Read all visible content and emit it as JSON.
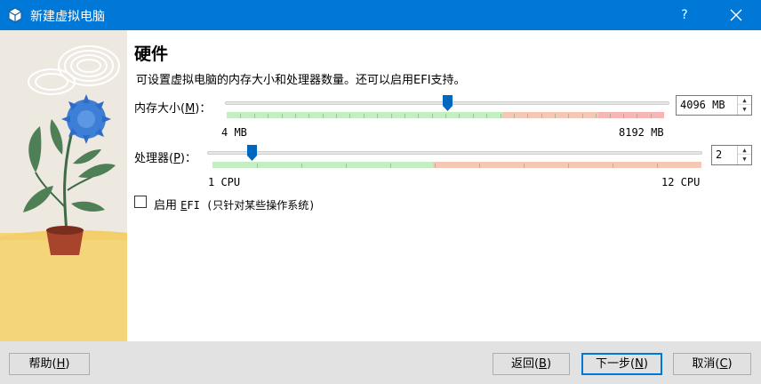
{
  "window": {
    "title": "新建虚拟电脑",
    "help_label": "?",
    "icon": "virtualbox-cube-icon",
    "close_icon": "close-icon"
  },
  "hardware": {
    "heading": "硬件",
    "description": "可设置虚拟电脑的内存大小和处理器数量。还可以启用EFI支持。",
    "memory": {
      "label_prefix": "内存大小(",
      "label_mnemonic": "M",
      "label_suffix": ")：",
      "value": "4096 MB",
      "min_label": "4 MB",
      "max_label": "8192 MB",
      "slider_fraction": 0.5,
      "zones": {
        "green_end": 0.63,
        "orange_end": 0.85
      },
      "colors": {
        "green": "#c3efc3",
        "orange": "#f4c8b4",
        "red": "#f7b6b6"
      }
    },
    "processor": {
      "label_prefix": "处理器(",
      "label_mnemonic": "P",
      "label_suffix": ")：",
      "value": "2",
      "min_label": "1 CPU",
      "max_label": "12 CPU",
      "slider_fraction": 0.09,
      "zones": {
        "green_end": 0.45
      },
      "colors": {
        "green": "#c3efc3",
        "orange": "#f4c8b4"
      }
    },
    "efi": {
      "checked": false,
      "label_prefix": "启用 ",
      "label_mnemonic": "E",
      "label_suffix": "FI (只针对某些操作系统)"
    }
  },
  "buttons": {
    "help_prefix": "帮助(",
    "help_mnemonic": "H",
    "help_suffix": ")",
    "back_prefix": "返回(",
    "back_mnemonic": "B",
    "back_suffix": ")",
    "next_prefix": "下一步(",
    "next_mnemonic": "N",
    "next_suffix": ")",
    "cancel_prefix": "取消(",
    "cancel_mnemonic": "C",
    "cancel_suffix": ")"
  },
  "colors": {
    "titlebar": "#0078d7",
    "accent": "#0078d7",
    "thumb": "#0067c0"
  }
}
